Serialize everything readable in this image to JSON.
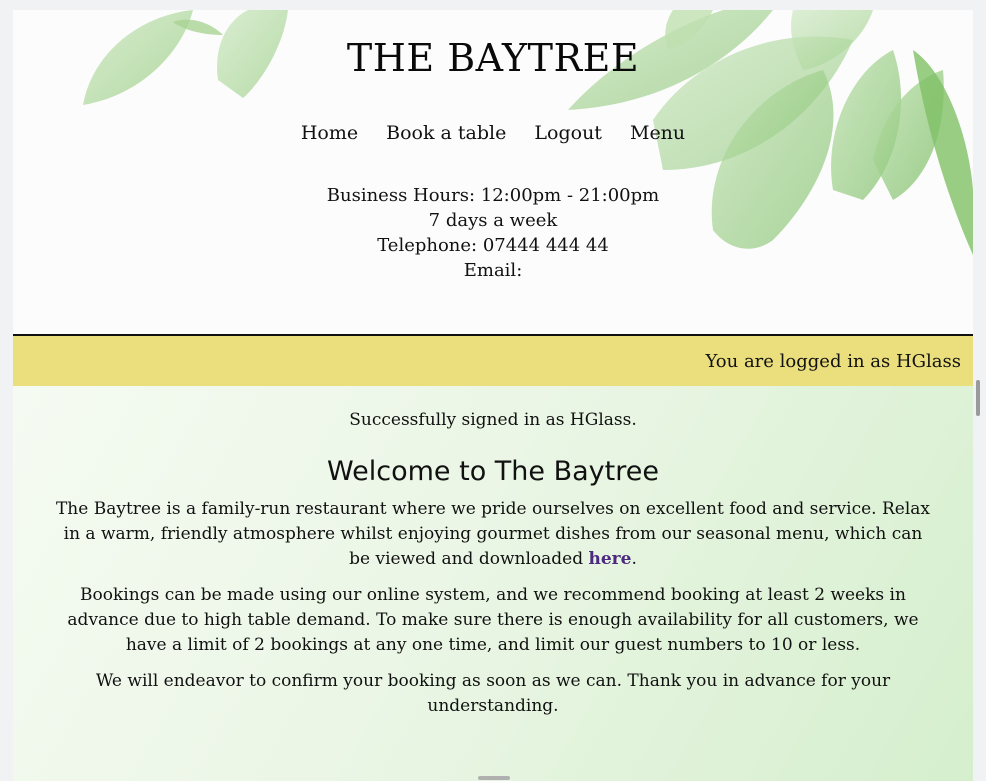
{
  "header": {
    "brand": "THE BAYTREE",
    "nav": [
      "Home",
      "Book a table",
      "Logout",
      "Menu"
    ],
    "hours": "Business Hours: 12:00pm - 21:00pm",
    "days": "7 days a week",
    "telephone": "Telephone: 07444 444 44",
    "email": "Email:"
  },
  "login_bar": {
    "text": "You are logged in as HGlass"
  },
  "main": {
    "flash": "Successfully signed in as HGlass.",
    "title": "Welcome to The Baytree",
    "intro_before_link": "The Baytree is a family-run restaurant where we pride ourselves on excellent food and service. Relax in a warm, friendly atmosphere whilst enjoying gourmet dishes from our seasonal menu, which can be viewed and downloaded ",
    "intro_link": "here",
    "intro_after_link": ".",
    "bookings": "Bookings can be made using our online system, and we recommend booking at least 2 weeks in advance due to high table demand. To make sure there is enough availability for all customers, we have a limit of 2 bookings at any one time, and limit our guest numbers to 10 or less.",
    "closing": "We will endeavor to confirm your booking as soon as we can. Thank you in advance for your understanding."
  },
  "colors": {
    "login_bar": "#ebde7c",
    "link": "#4b2a7f",
    "leaf": "#8fc77a"
  }
}
